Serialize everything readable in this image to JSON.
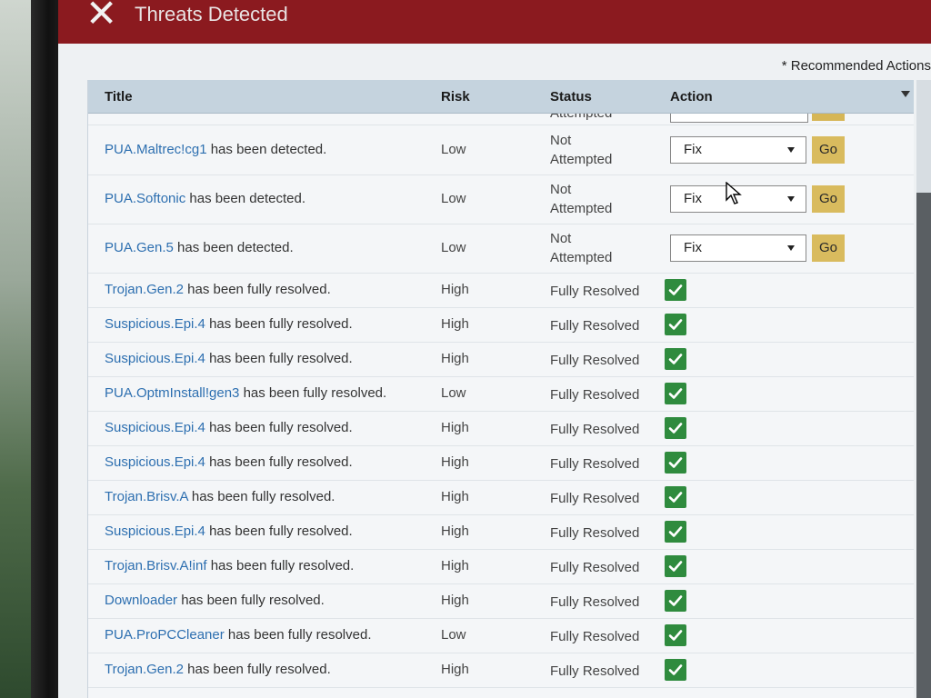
{
  "window": {
    "title": "Threats Detected"
  },
  "notice": "* Recommended Actions",
  "columns": {
    "title": "Title",
    "risk": "Risk",
    "status": "Status",
    "action": "Action"
  },
  "partial_row": {
    "status": "Attempted"
  },
  "rows": [
    {
      "name": "PUA.Maltrec!cg1",
      "suffix": "has been detected.",
      "risk": "Low",
      "status_line1": "Not",
      "status_line2": "Attempted",
      "action_value": "Fix",
      "go_label": "Go"
    },
    {
      "name": "PUA.Softonic",
      "suffix": "has been detected.",
      "risk": "Low",
      "status_line1": "Not",
      "status_line2": "Attempted",
      "action_value": "Fix",
      "go_label": "Go"
    },
    {
      "name": "PUA.Gen.5",
      "suffix": "has been detected.",
      "risk": "Low",
      "status_line1": "Not",
      "status_line2": "Attempted",
      "action_value": "Fix",
      "go_label": "Go"
    },
    {
      "name": "Trojan.Gen.2",
      "suffix": "has been fully resolved.",
      "risk": "High",
      "status": "Fully Resolved"
    },
    {
      "name": "Suspicious.Epi.4",
      "suffix": "has been fully resolved.",
      "risk": "High",
      "status": "Fully Resolved"
    },
    {
      "name": "Suspicious.Epi.4",
      "suffix": "has been fully resolved.",
      "risk": "High",
      "status": "Fully Resolved"
    },
    {
      "name": "PUA.OptmInstall!gen3",
      "suffix": "has been fully resolved.",
      "risk": "Low",
      "status": "Fully Resolved"
    },
    {
      "name": "Suspicious.Epi.4",
      "suffix": "has been fully resolved.",
      "risk": "High",
      "status": "Fully Resolved"
    },
    {
      "name": "Suspicious.Epi.4",
      "suffix": "has been fully resolved.",
      "risk": "High",
      "status": "Fully Resolved"
    },
    {
      "name": "Trojan.Brisv.A",
      "suffix": "has been fully resolved.",
      "risk": "High",
      "status": "Fully Resolved"
    },
    {
      "name": "Suspicious.Epi.4",
      "suffix": "has been fully resolved.",
      "risk": "High",
      "status": "Fully Resolved"
    },
    {
      "name": "Trojan.Brisv.A!inf",
      "suffix": "has been fully resolved.",
      "risk": "High",
      "status": "Fully Resolved"
    },
    {
      "name": "Downloader",
      "suffix": "has been fully resolved.",
      "risk": "High",
      "status": "Fully Resolved"
    },
    {
      "name": "PUA.ProPCCleaner",
      "suffix": "has been fully resolved.",
      "risk": "Low",
      "status": "Fully Resolved"
    },
    {
      "name": "Trojan.Gen.2",
      "suffix": "has been fully resolved.",
      "risk": "High",
      "status": "Fully Resolved"
    }
  ],
  "icons": {
    "close": "close-icon",
    "check": "checkmark-icon",
    "caret": "chevron-down-icon",
    "pointer": "mouse-cursor-icon"
  },
  "colors": {
    "titlebar": "#8b1a1f",
    "header": "#c5d3de",
    "link": "#2d6fb0",
    "go": "#d9bb5e",
    "check": "#2f8b3e"
  }
}
